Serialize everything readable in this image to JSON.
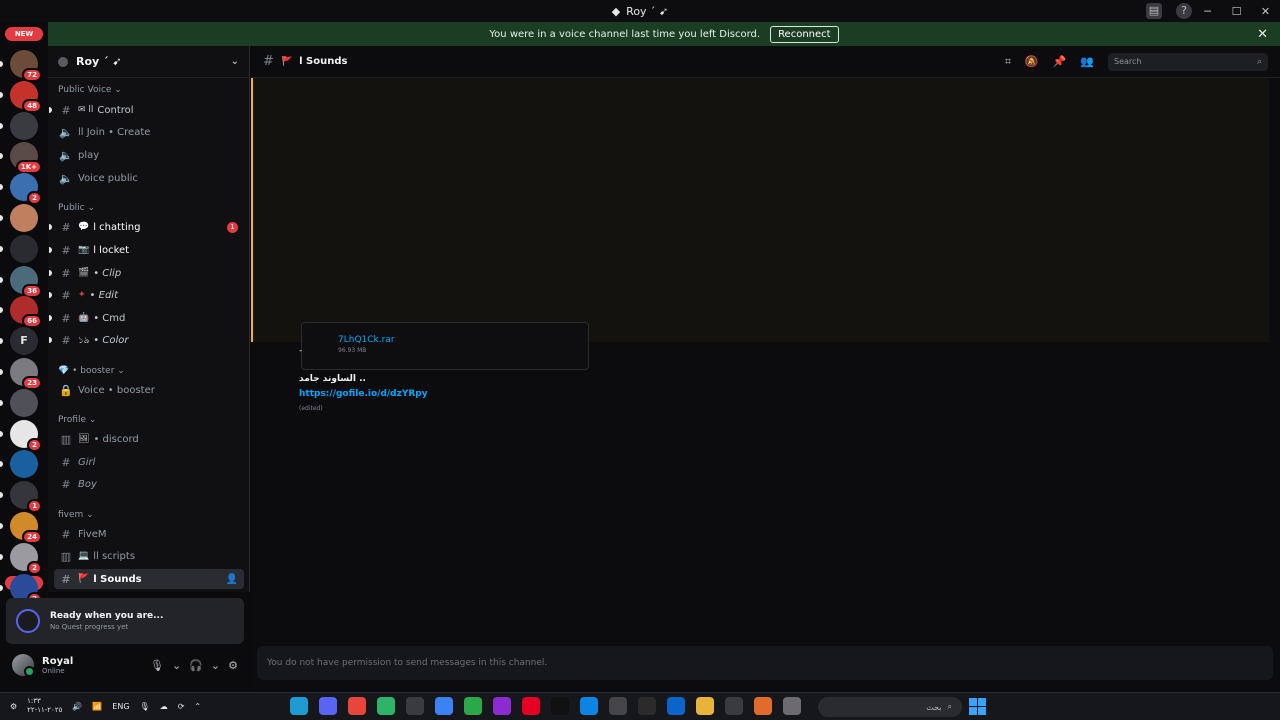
{
  "window": {
    "title": "Roy ´ ➹",
    "min": "─",
    "max": "☐",
    "close": "✕"
  },
  "banner": {
    "text": "You were in a voice channel last time you left Discord.",
    "button": "Reconnect",
    "close": "✕"
  },
  "rail": {
    "servers": [
      {
        "badge": "72",
        "color": "#6b4b3a"
      },
      {
        "badge": "48",
        "color": "#c4332b"
      },
      {
        "badge": "",
        "color": "#3a3b40"
      },
      {
        "badge": "1K+",
        "color": "#5a4a45"
      },
      {
        "badge": "2",
        "color": "#3a6fb0"
      },
      {
        "badge": "",
        "color": "#c08060"
      },
      {
        "badge": "",
        "color": "#2a2b30"
      },
      {
        "badge": "36",
        "color": "#4b6b7a"
      },
      {
        "badge": "66",
        "color": "#b02b2b"
      },
      {
        "badge": "",
        "color": "#2a2b30",
        "letter": "F"
      },
      {
        "badge": "23",
        "color": "#7a7a80"
      },
      {
        "badge": "",
        "color": "#505158"
      },
      {
        "badge": "2",
        "color": "#e6e6e6"
      },
      {
        "badge": "",
        "color": "#1a5fa0"
      },
      {
        "badge": "1",
        "color": "#35363c"
      },
      {
        "badge": "24",
        "color": "#d08a2a"
      },
      {
        "badge": "2",
        "color": "#9a9aa0"
      },
      {
        "badge": "2",
        "color": "#2a4b9a"
      }
    ],
    "new_label": "NEW"
  },
  "guild": {
    "name": "Roy ´ ➹",
    "chevron": "⌄"
  },
  "categories": {
    "public_voice": "Public Voice ⌄",
    "public": "Public ⌄",
    "booster": "💎 • booster ⌄",
    "profile": "Profile ⌄",
    "fivem": "fivem ⌄"
  },
  "channels": {
    "control": "Control",
    "control_emoji": "✉ ll",
    "join": "ll Join • Create",
    "play": "play",
    "voice_public": "Voice public",
    "chatting": "l chatting",
    "chatting_unread": "1",
    "locket": "l locket",
    "clip": "• Clip",
    "edit": "• Edit",
    "cmd": "• Cmd",
    "color": "• Color",
    "color_emoji": "১ঌ",
    "voice_booster": "Voice • booster",
    "discord": "• discord",
    "girl": "Girl",
    "boy": "Boy",
    "fivem": "FiveM",
    "scripts": "ll scripts",
    "sounds": "l Sounds"
  },
  "quest": {
    "title": "Ready when you are...",
    "subtitle": "No Quest progress yet"
  },
  "user": {
    "name": "Royal",
    "status": "Online"
  },
  "header": {
    "channel": "l Sounds",
    "search_placeholder": "Search"
  },
  "messages": {
    "attachment_name": "7LhQ1Ck.rar",
    "attachment_size": "96.93 MB",
    "dash": "-",
    "text": "الساوند جامد ..",
    "link": "https://gofile.io/d/dzYRpy",
    "edited": "(edited)"
  },
  "composer": {
    "placeholder": "You do not have permission to send messages in this channel."
  },
  "taskbar": {
    "lang": "ENG",
    "date": "٢٠٢٥-١١-٢٢",
    "time": "١:٣٣",
    "search_text": "بحث",
    "apps": [
      "#1b9bd1",
      "#5865f2",
      "#e8453c",
      "#2db36a",
      "#3a3b40",
      "#3b82f6",
      "#2aa84a",
      "#8b2cd1",
      "#e60023",
      "#111111",
      "#0b84e3",
      "#444449",
      "#2b2b2b",
      "#0a64c9",
      "#e8b33a",
      "#3a3b40",
      "#e06b2a",
      "#6b6b70"
    ]
  }
}
